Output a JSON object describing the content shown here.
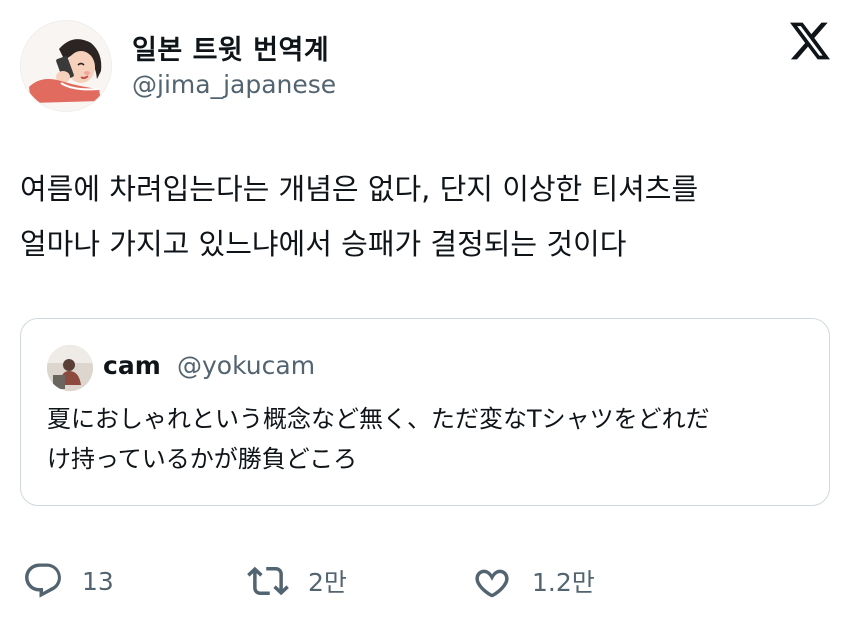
{
  "author": {
    "display_name": "일본 트윗 번역계",
    "handle": "@jima_japanese"
  },
  "tweet": {
    "lines": [
      "여름에 차려입는다는 개념은 없다, 단지 이상한 티셔츠를",
      "얼마나 가지고 있느냐에서 승패가 결정되는 것이다"
    ]
  },
  "quote": {
    "display_name": "cam",
    "handle": "@yokucam",
    "lines": [
      "夏におしゃれという概念など無く、ただ変なTシャツをどれだ",
      "け持っているかが勝負どころ"
    ]
  },
  "actions": {
    "reply_count": "13",
    "retweet_count": "2만",
    "like_count": "1.2만"
  },
  "icons": {
    "logo": "x-logo-icon",
    "reply": "reply-icon",
    "retweet": "retweet-icon",
    "like": "heart-icon"
  },
  "colors": {
    "text": "#0f1419",
    "secondary": "#536471",
    "border": "#cfd9de"
  }
}
